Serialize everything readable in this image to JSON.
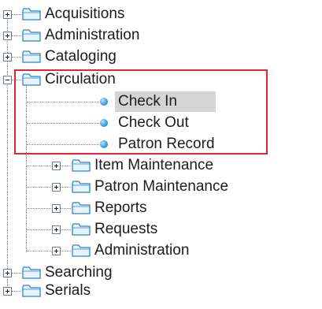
{
  "tree": {
    "items": [
      {
        "label": "Acquisitions"
      },
      {
        "label": "Administration"
      },
      {
        "label": "Cataloging"
      },
      {
        "label": "Circulation",
        "expanded": true
      },
      {
        "label": "Check In",
        "selected": true
      },
      {
        "label": "Check Out"
      },
      {
        "label": "Patron Record"
      },
      {
        "label": "Item Maintenance"
      },
      {
        "label": "Patron Maintenance"
      },
      {
        "label": "Reports"
      },
      {
        "label": "Requests"
      },
      {
        "label": "Administration"
      },
      {
        "label": "Searching"
      },
      {
        "label": "Serials"
      }
    ]
  },
  "colors": {
    "highlight_border": "#e0282e",
    "selected_background": "#d4d4d4",
    "folder_fill": "#e8f4fc",
    "folder_stroke": "#2f84c8"
  }
}
